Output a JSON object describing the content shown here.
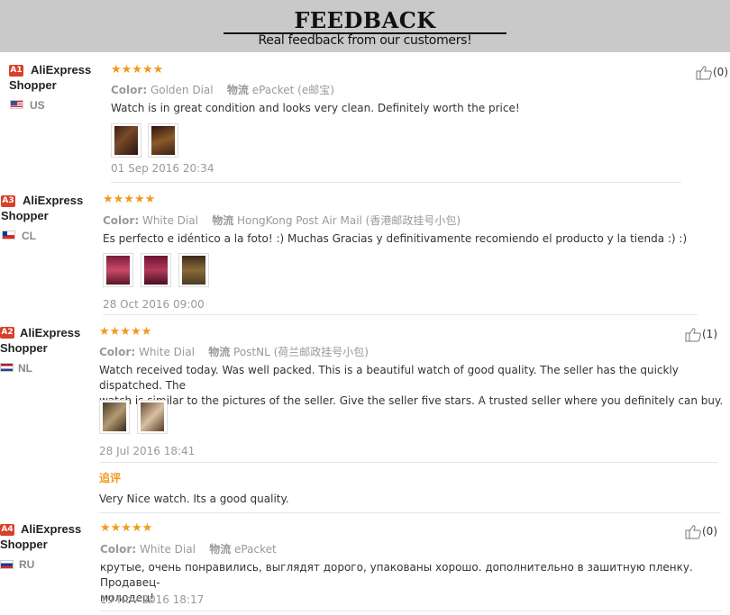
{
  "header": {
    "title": "FEEDBACK",
    "subtitle": "Real feedback from our customers!"
  },
  "reviews": [
    {
      "badge": "A1",
      "user_line1": "AliExpress",
      "user_line2": "Shopper",
      "country": "US",
      "stars": "★★★★★",
      "color_label": "Color:",
      "color_value": "Golden Dial",
      "ship_label": "物流",
      "ship_value": "ePacket (e邮宝)",
      "text": "Watch is in great condition and looks very clean. Definitely worth the price!",
      "date": "01 Sep 2016 20:34",
      "likes": "(0)"
    },
    {
      "badge": "A3",
      "user_line1": "AliExpress",
      "user_line2": "Shopper",
      "country": "CL",
      "stars": "★★★★★",
      "color_label": "Color:",
      "color_value": "White Dial",
      "ship_label": "物流",
      "ship_value": "HongKong Post Air Mail (香港邮政挂号小包)",
      "text": "Es perfecto e idéntico a la foto! :) Muchas Gracias y definitivamente recomiendo el producto y la tienda :) :)",
      "date": "28 Oct 2016 09:00"
    },
    {
      "badge": "A2",
      "user_line1": "AliExpress",
      "user_line2": "Shopper",
      "country": "NL",
      "stars": "★★★★★",
      "color_label": "Color:",
      "color_value": "White Dial",
      "ship_label": "物流",
      "ship_value": "PostNL (荷兰邮政挂号小包)",
      "text_line1": "Watch received today. Was well packed. This is a beautiful watch of good quality. The seller has the quickly dispatched. The",
      "text_line2": "watch is similar to the pictures of the seller. Give the seller five stars. A trusted seller where you definitely can buy.",
      "date": "28 Jul 2016 18:41",
      "followup_label": "追评",
      "followup_text": "Very Nice watch. Its a good quality.",
      "likes": "(1)"
    },
    {
      "badge": "A4",
      "user_line1": "AliExpress",
      "user_line2": "Shopper",
      "country": "RU",
      "stars": "★★★★★",
      "color_label": "Color:",
      "color_value": "White Dial",
      "ship_label": "物流",
      "ship_value": "ePacket",
      "text_line1": "крутые, очень понравились, выглядят дорого, упакованы хорошо. дополнительно в зашитную пленку. Продавец-",
      "text_line2": "молодец!",
      "date": "19 Nov 2016 18:17",
      "likes": "(0)"
    }
  ],
  "icons": {
    "like": "thumbs-up-icon"
  },
  "colors": {
    "header_bg": "#c9c9c9",
    "star": "#f29a1d",
    "badge": "#d9402a"
  }
}
